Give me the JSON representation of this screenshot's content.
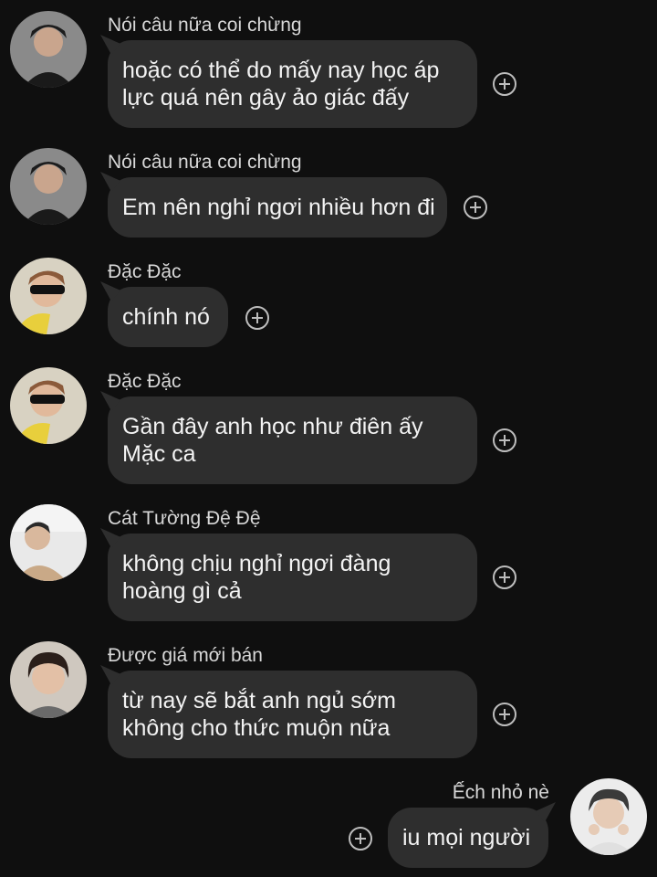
{
  "messages": [
    {
      "sender": "Nói câu nữa coi chừng",
      "lines": [
        "hoặc có thể do mấy nay học áp",
        "lực quá nên gây ảo giác đấy"
      ]
    },
    {
      "sender": "Nói câu nữa coi chừng",
      "lines": [
        "Em nên nghỉ ngơi nhiều hơn đi"
      ]
    },
    {
      "sender": "Đặc Đặc",
      "lines": [
        "chính nó"
      ]
    },
    {
      "sender": "Đặc Đặc",
      "lines": [
        "Gần đây anh học như điên ấy",
        "Mặc ca"
      ]
    },
    {
      "sender": "Cát Tường Đệ Đệ",
      "lines": [
        "không chịu nghỉ ngơi đàng",
        "hoàng gì cả"
      ]
    },
    {
      "sender": "Được giá mới bán",
      "lines": [
        "từ nay sẽ bắt anh ngủ sớm",
        "không cho thức muộn nữa"
      ]
    },
    {
      "sender": "Ếch nhỏ nè",
      "lines": [
        "iu mọi người"
      ]
    }
  ],
  "icons": {
    "react": "add-reaction-icon",
    "avatar": "user-avatar"
  },
  "colors": {
    "background": "#0f0f0f",
    "bubble": "#2e2e2e",
    "text": "#f3f3f3"
  }
}
